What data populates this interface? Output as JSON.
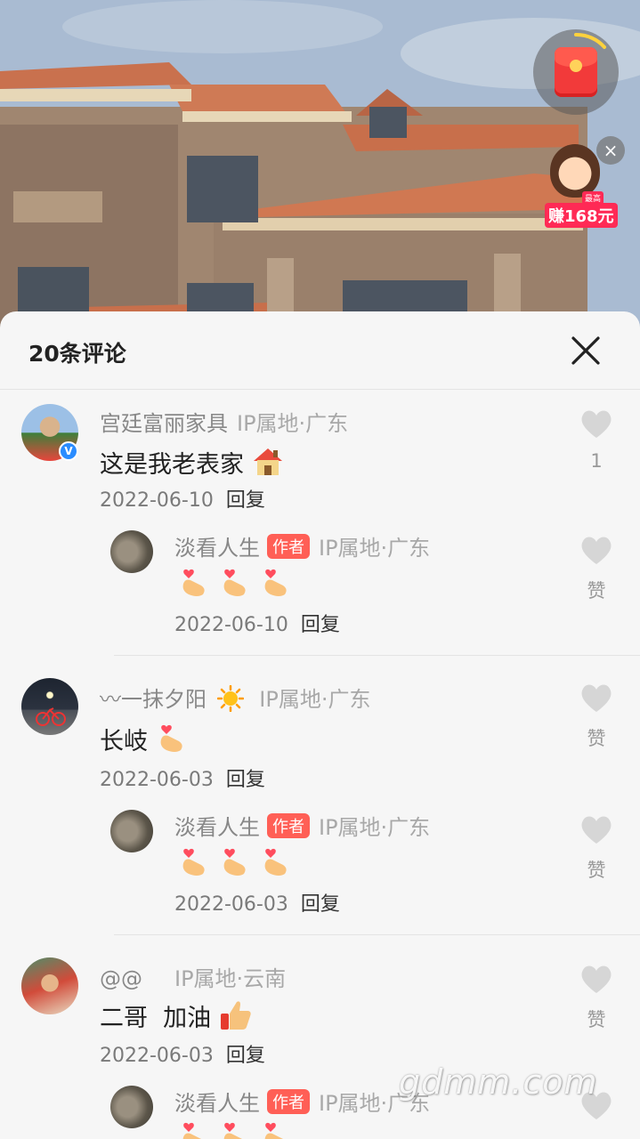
{
  "video": {
    "scene": "villa-background"
  },
  "red_packet": {
    "ring_progress": 0.18,
    "promo_tag": "最高",
    "promo_label": "赚168元"
  },
  "sheet": {
    "title": "20条评论"
  },
  "comments": [
    {
      "user": "宫廷富丽家具",
      "ip": "IP属地·广东",
      "text": "这是我老表家",
      "emoji": "house",
      "date": "2022-06-10",
      "reply_label": "回复",
      "likes": "1",
      "verified": "V",
      "replies": [
        {
          "user": "淡看人生",
          "badge": "作者",
          "ip": "IP属地·广东",
          "emoji": "finger-heart x3",
          "date": "2022-06-10",
          "reply_label": "回复",
          "like_label": "赞"
        }
      ]
    },
    {
      "user": "〰一抹夕阳",
      "user_emoji": "sun",
      "ip": "IP属地·广东",
      "text": "长岐",
      "emoji": "finger-heart",
      "date": "2022-06-03",
      "reply_label": "回复",
      "like_label": "赞",
      "replies": [
        {
          "user": "淡看人生",
          "badge": "作者",
          "ip": "IP属地·广东",
          "emoji": "finger-heart x3",
          "date": "2022-06-03",
          "reply_label": "回复",
          "like_label": "赞"
        }
      ]
    },
    {
      "user": "@@",
      "ip": "IP属地·云南",
      "text": "二哥  加油",
      "emoji": "thumbs-up",
      "date": "2022-06-03",
      "reply_label": "回复",
      "like_label": "赞",
      "replies": [
        {
          "user": "淡看人生",
          "badge": "作者",
          "ip": "IP属地·广东",
          "emoji": "finger-heart x3"
        }
      ]
    }
  ],
  "watermark": "gdmm.com"
}
